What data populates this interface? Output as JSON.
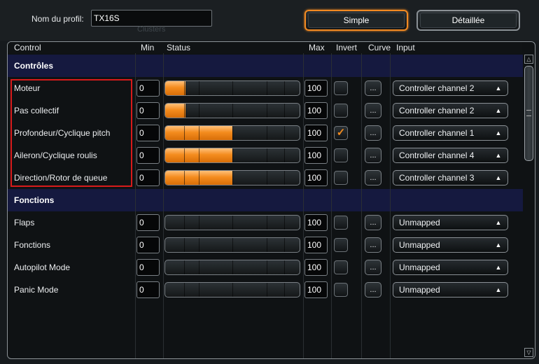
{
  "profile": {
    "label": "Nom du profil:",
    "value": "TX16S",
    "ghost_text": "Clusters"
  },
  "modes": {
    "simple": "Simple",
    "detailed": "Détaillée",
    "active": "simple"
  },
  "columns": {
    "control": "Control",
    "min": "Min",
    "status": "Status",
    "max": "Max",
    "invert": "Invert",
    "curve": "Curve",
    "input": "Input"
  },
  "colors": {
    "accent": "#f48c1e",
    "section_bg": "#15193f",
    "highlight_border": "#d81b1b"
  },
  "curve_label": "...",
  "sections": [
    {
      "title": "Contrôles",
      "rows": [
        {
          "label": "Moteur",
          "min": "0",
          "max": "100",
          "status": 0.15,
          "invert": false,
          "input": "Controller channel 2"
        },
        {
          "label": "Pas collectif",
          "min": "0",
          "max": "100",
          "status": 0.15,
          "invert": false,
          "input": "Controller channel 2"
        },
        {
          "label": "Profondeur/Cyclique pitch",
          "min": "0",
          "max": "100",
          "status": 0.5,
          "invert": true,
          "input": "Controller channel 1"
        },
        {
          "label": "Aileron/Cyclique roulis",
          "min": "0",
          "max": "100",
          "status": 0.5,
          "invert": false,
          "input": "Controller channel 4"
        },
        {
          "label": "Direction/Rotor de queue",
          "min": "0",
          "max": "100",
          "status": 0.5,
          "invert": false,
          "input": "Controller channel 3"
        }
      ]
    },
    {
      "title": "Fonctions",
      "rows": [
        {
          "label": "Flaps",
          "min": "0",
          "max": "100",
          "status": 0,
          "invert": false,
          "input": "Unmapped"
        },
        {
          "label": "Fonctions",
          "min": "0",
          "max": "100",
          "status": 0,
          "invert": false,
          "input": "Unmapped"
        },
        {
          "label": "Autopilot Mode",
          "min": "0",
          "max": "100",
          "status": 0,
          "invert": false,
          "input": "Unmapped"
        },
        {
          "label": "Panic Mode",
          "min": "0",
          "max": "100",
          "status": 0,
          "invert": false,
          "input": "Unmapped"
        }
      ]
    }
  ]
}
